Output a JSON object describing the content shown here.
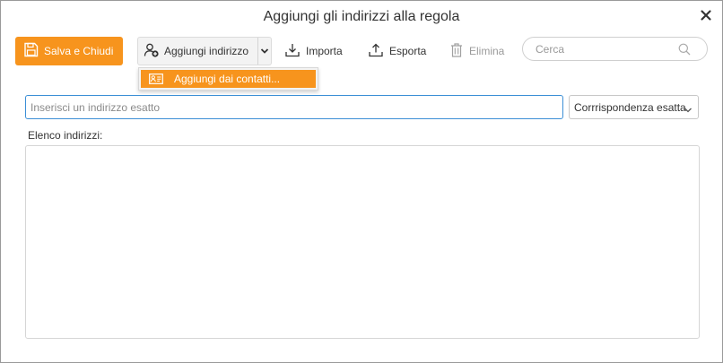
{
  "window": {
    "title": "Aggiungi gli indirizzi alla regola"
  },
  "toolbar": {
    "save_label": "Salva e Chiudi",
    "add_label": "Aggiungi indirizzo",
    "import_label": "Importa",
    "export_label": "Esporta",
    "delete_label": "Elimina",
    "search_placeholder": "Cerca"
  },
  "dropdown": {
    "items": [
      {
        "label": "Aggiungi dai contatti..."
      }
    ]
  },
  "form": {
    "address_placeholder": "Inserisci un indirizzo esatto",
    "address_value": "",
    "match_selected": "Corrrispondenza esatta",
    "list_label": "Elenco indirizzi:"
  },
  "colors": {
    "accent": "#f7941d",
    "focus_border": "#3c8fd6"
  },
  "icons": {
    "save": "floppy-disk-icon",
    "add_user": "user-plus-icon",
    "split_arrow": "chevron-down-icon",
    "import": "download-icon",
    "export": "upload-icon",
    "delete": "trash-icon",
    "search": "search-icon",
    "close": "close-icon",
    "contact_card": "contact-card-icon"
  }
}
